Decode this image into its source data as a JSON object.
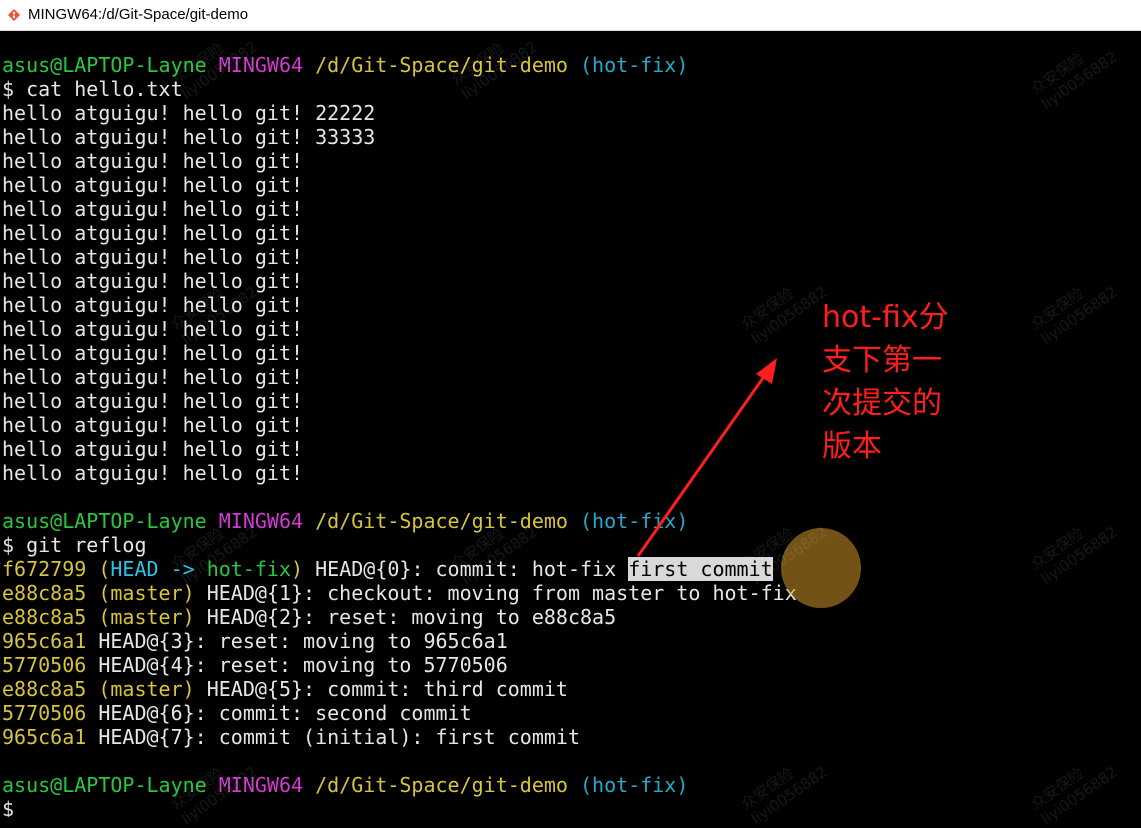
{
  "window": {
    "title": "MINGW64:/d/Git-Space/git-demo",
    "icon": "git-icon"
  },
  "prompt": {
    "user_host": "asus@LAPTOP-Layne",
    "shell": "MINGW64",
    "path": "/d/Git-Space/git-demo",
    "branch": "(hot-fix)",
    "symbol": "$"
  },
  "commands": {
    "cat": "cat hello.txt",
    "reflog": "git reflog"
  },
  "cat_output": [
    "hello atguigu! hello git! 22222",
    "hello atguigu! hello git! 33333",
    "hello atguigu! hello git!",
    "hello atguigu! hello git!",
    "hello atguigu! hello git!",
    "hello atguigu! hello git!",
    "hello atguigu! hello git!",
    "hello atguigu! hello git!",
    "hello atguigu! hello git!",
    "hello atguigu! hello git!",
    "hello atguigu! hello git!",
    "hello atguigu! hello git!",
    "hello atguigu! hello git!",
    "hello atguigu! hello git!",
    "hello atguigu! hello git!",
    "hello atguigu! hello git!"
  ],
  "reflog": [
    {
      "hash": "f672799",
      "decoration": "head",
      "ref": "HEAD@{0}",
      "message": ": commit: hot-fix ",
      "highlight": "first commit"
    },
    {
      "hash": "e88c8a5",
      "decoration": "master",
      "ref": "HEAD@{1}",
      "message": ": checkout: moving from master to hot-fix",
      "highlight": ""
    },
    {
      "hash": "e88c8a5",
      "decoration": "master",
      "ref": "HEAD@{2}",
      "message": ": reset: moving to e88c8a5",
      "highlight": ""
    },
    {
      "hash": "965c6a1",
      "decoration": "",
      "ref": "HEAD@{3}",
      "message": ": reset: moving to 965c6a1",
      "highlight": ""
    },
    {
      "hash": "5770506",
      "decoration": "",
      "ref": "HEAD@{4}",
      "message": ": reset: moving to 5770506",
      "highlight": ""
    },
    {
      "hash": "e88c8a5",
      "decoration": "master",
      "ref": "HEAD@{5}",
      "message": ": commit: third commit",
      "highlight": ""
    },
    {
      "hash": "5770506",
      "decoration": "",
      "ref": "HEAD@{6}",
      "message": ": commit: second commit",
      "highlight": ""
    },
    {
      "hash": "965c6a1",
      "decoration": "",
      "ref": "HEAD@{7}",
      "message": ": commit (initial): first commit",
      "highlight": ""
    }
  ],
  "decorations": {
    "head_open": "(",
    "head_label": "HEAD -> ",
    "head_branch": "hot-fix",
    "head_close": ")",
    "master": "(master)"
  },
  "annotation": {
    "lines": [
      "hot-fix分",
      "支下第一",
      "次提交的",
      "版本"
    ],
    "color": "#ff1e1e"
  },
  "watermark": {
    "line1": "众安保险",
    "line2": "liyi0056882"
  },
  "colors": {
    "user_host": "#28c83e",
    "shell": "#d339d3",
    "path": "#d7c43a",
    "branch": "#2aa7c9",
    "background": "#000000",
    "text": "#e6e6e6"
  }
}
